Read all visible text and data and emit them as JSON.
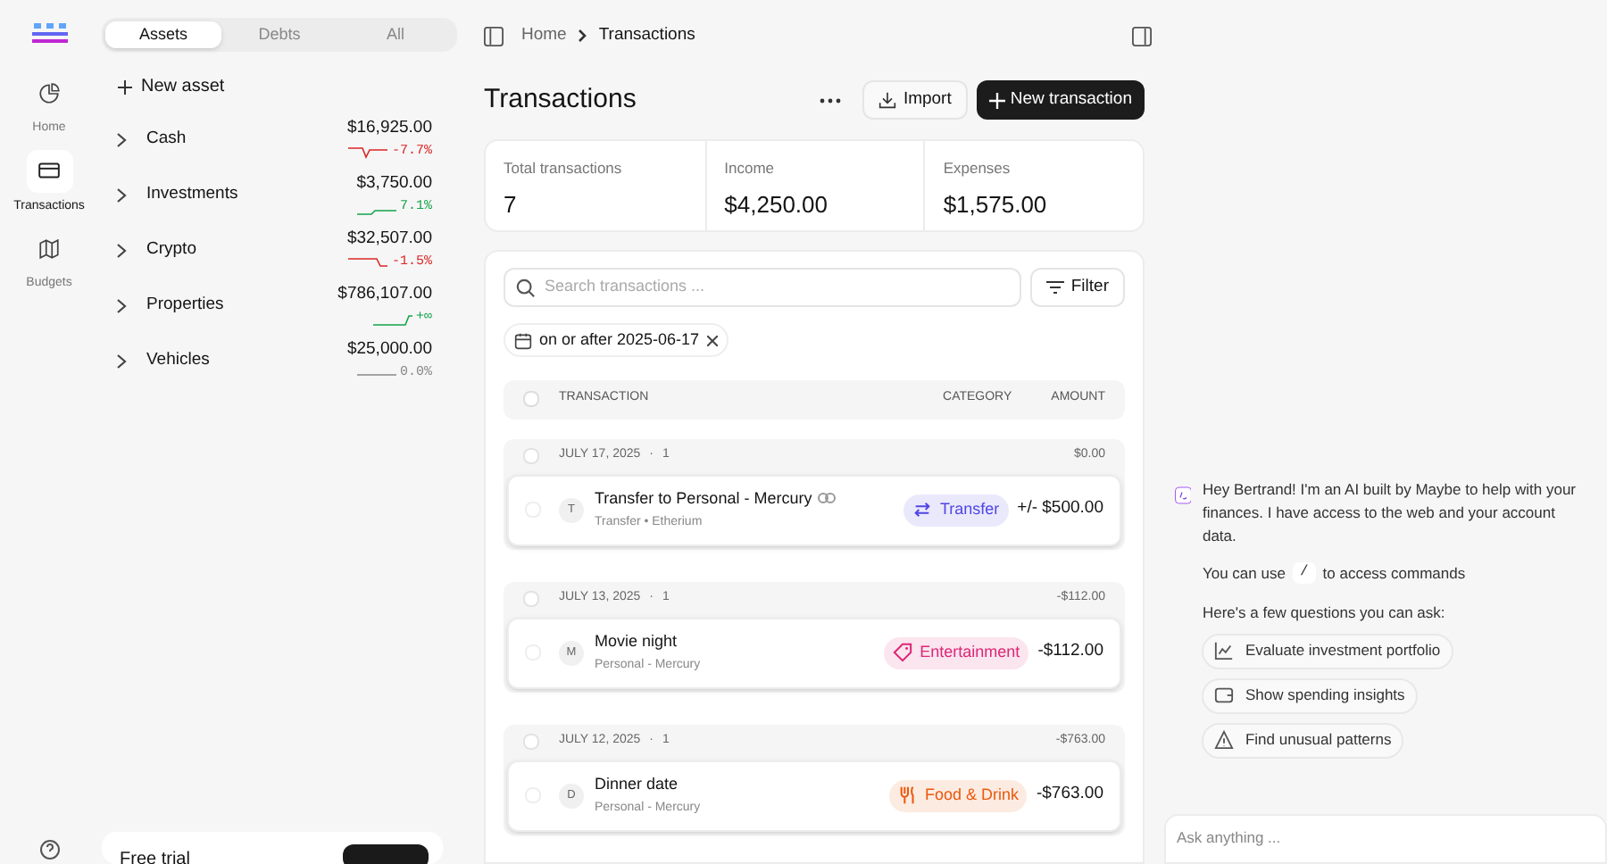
{
  "nav": [
    {
      "label": "Home",
      "selected": false
    },
    {
      "label": "Transactions",
      "selected": true
    },
    {
      "label": "Budgets",
      "selected": false
    }
  ],
  "account_tabs": [
    {
      "label": "Assets",
      "selected": true
    },
    {
      "label": "Debts",
      "selected": false
    },
    {
      "label": "All",
      "selected": false
    }
  ],
  "new_asset": "New asset",
  "accounts": [
    {
      "name": "Cash",
      "balance": "$16,925.00",
      "change": "-7.7%",
      "color": "#dc2626"
    },
    {
      "name": "Investments",
      "balance": "$3,750.00",
      "change": "7.1%",
      "color": "#16a34a"
    },
    {
      "name": "Crypto",
      "balance": "$32,507.00",
      "change": "-1.5%",
      "color": "#dc2626"
    },
    {
      "name": "Properties",
      "balance": "$786,107.00",
      "change": "+∞",
      "color": "#16a34a"
    },
    {
      "name": "Vehicles",
      "balance": "$25,000.00",
      "change": "0.0%",
      "color": "#888888"
    }
  ],
  "trial_card": {
    "title": "Free trial"
  },
  "breadcrumb": [
    "Home",
    "Transactions"
  ],
  "page_title": "Transactions",
  "import_button": "Import",
  "new_button": "New transaction",
  "stats": [
    {
      "label": "Total transactions",
      "value": "7"
    },
    {
      "label": "Income",
      "value": "$4,250.00"
    },
    {
      "label": "Expenses",
      "value": "$1,575.00"
    }
  ],
  "search": {
    "placeholder": "Search transactions ..."
  },
  "filter_button": "Filter",
  "filter_chip": "on or after 2025-06-17",
  "select_all": {
    "checked": false
  },
  "columns": [
    "TRANSACTION",
    "CATEGORY",
    "AMOUNT"
  ],
  "groups": [
    {
      "checked": false,
      "date": "JULY 17, 2025",
      "separator": "·",
      "count": "1",
      "total": "$0.00",
      "rows": [
        {
          "checked": false,
          "initial": "T",
          "name": "Transfer to Personal - Mercury",
          "linked": true,
          "detail": "Transfer • Etherium",
          "category": {
            "label": "Transfer",
            "color": "#4f46e5"
          },
          "amount": "+/- $500.00"
        }
      ]
    },
    {
      "checked": false,
      "date": "JULY 13, 2025",
      "separator": "·",
      "count": "1",
      "total": "-$112.00",
      "rows": [
        {
          "checked": false,
          "initial": "M",
          "name": "Movie night",
          "linked": false,
          "detail": "Personal - Mercury",
          "category": {
            "label": "Entertainment",
            "color": "#db2777"
          },
          "amount": "-$112.00"
        }
      ]
    },
    {
      "checked": false,
      "date": "JULY 12, 2025",
      "separator": "·",
      "count": "1",
      "total": "-$763.00",
      "rows": [
        {
          "checked": false,
          "initial": "D",
          "name": "Dinner date",
          "linked": false,
          "detail": "Personal - Mercury",
          "category": {
            "label": "Food & Drink",
            "color": "#ea580c"
          },
          "amount": "-$763.00"
        }
      ]
    }
  ],
  "chat": {
    "intro": "Hey Bertrand! I'm an AI built by Maybe to help with your finances. I have access to the web and your account data.",
    "commands_before": "You can use",
    "command_key": "/",
    "commands_after": "to access commands",
    "questions_heading": "Here's a few questions you can ask:",
    "suggestions": [
      {
        "label": "Evaluate investment portfolio"
      },
      {
        "label": "Show spending insights"
      },
      {
        "label": "Find unusual patterns"
      }
    ],
    "input": {
      "placeholder": "Ask anything ..."
    }
  }
}
